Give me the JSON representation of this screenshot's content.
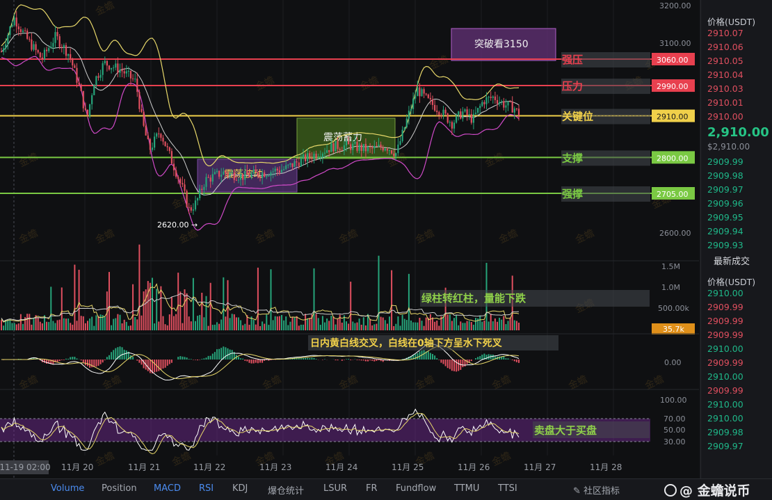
{
  "chart": {
    "price_ticks": [
      "3200.00",
      "3100.00",
      "2600.00"
    ],
    "level_lines": [
      {
        "label": "强压",
        "price_tag": "3060.00",
        "color": "#e8404f"
      },
      {
        "label": "压力",
        "price_tag": "2990.00",
        "color": "#e8404f"
      },
      {
        "label": "关键位",
        "price_tag": "2910.00",
        "color": "#f0d04a"
      },
      {
        "label": "支撑",
        "price_tag": "2800.00",
        "color": "#7ac943"
      },
      {
        "label": "强撑",
        "price_tag": "2705.00",
        "color": "#7ac943"
      }
    ],
    "low_marker": "2620.00 →",
    "box_breakout": "突破看3150",
    "box_consolidation": "震荡波动",
    "box_accumulation": "震荡蓄力",
    "volume_ticks": [
      "1.5M",
      "1.0M",
      "500.00k"
    ],
    "volume_tag": "35.7k",
    "volume_note": "绿柱转红柱，量能下跌",
    "macd_note": "日内黄白线交叉，白线在0轴下方呈水下死叉",
    "macd_zero": "0.00",
    "rsi_ticks": [
      "100.00",
      "70.00",
      "50.00",
      "30.00"
    ],
    "rsi_note": "卖盘大于买盘",
    "date_labels": [
      "-11-19 02:00",
      "11月 20",
      "11月 21",
      "11月 22",
      "11月 23",
      "11月 24",
      "11月 25",
      "11月 26",
      "11月 27",
      "11月 28"
    ],
    "watermark": "金蟾",
    "colors": {
      "up": "#26a47a",
      "down": "#e04f5f",
      "yellow": "#f0d04a",
      "box_purple": "#6b3a8a",
      "box_green": "#4d7a1f"
    }
  },
  "orderbook": {
    "header": "价格(USDT)",
    "asks": [
      "2910.07",
      "2910.06",
      "2910.05",
      "2910.04",
      "2910.03",
      "2910.01",
      "2910.00"
    ],
    "last_price": "2,910.00",
    "last_price_sub": "$2,910.00",
    "bids": [
      "2909.99",
      "2909.98",
      "2909.97",
      "2909.96",
      "2909.95",
      "2909.94",
      "2909.93"
    ],
    "trades_title": "最新成交",
    "trades_header": "价格(USDT)",
    "trades": [
      {
        "price": "2910.00",
        "side": "buy"
      },
      {
        "price": "2909.99",
        "side": "sell"
      },
      {
        "price": "2909.99",
        "side": "sell"
      },
      {
        "price": "2909.99",
        "side": "sell"
      },
      {
        "price": "2910.00",
        "side": "buy"
      },
      {
        "price": "2909.99",
        "side": "sell"
      },
      {
        "price": "2910.00",
        "side": "buy"
      },
      {
        "price": "2909.99",
        "side": "sell"
      },
      {
        "price": "2910.00",
        "side": "buy"
      },
      {
        "price": "2910.00",
        "side": "buy"
      },
      {
        "price": "2909.98",
        "side": "buy"
      },
      {
        "price": "2909.97",
        "side": "buy"
      }
    ]
  },
  "bottom_tabs": [
    {
      "label": "Volume",
      "active": true
    },
    {
      "label": "Position",
      "active": false
    },
    {
      "label": "MACD",
      "active": true
    },
    {
      "label": "RSI",
      "active": true
    },
    {
      "label": "KDJ",
      "active": false
    },
    {
      "label": "爆仓统计",
      "active": false
    },
    {
      "label": "LSUR",
      "active": false
    },
    {
      "label": "FR",
      "active": false
    },
    {
      "label": "Fundflow",
      "active": false
    },
    {
      "label": "TTMU",
      "active": false
    },
    {
      "label": "TTSI",
      "active": false
    }
  ],
  "community_label": "社区指标",
  "brand": "金蟾说币"
}
